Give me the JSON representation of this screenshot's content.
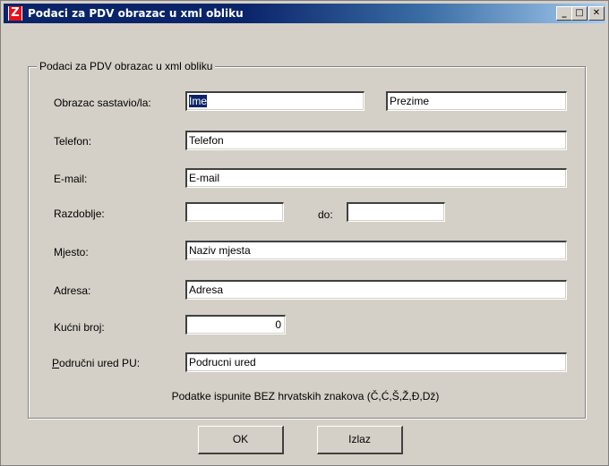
{
  "window": {
    "title": "Podaci za PDV obrazac u xml obliku",
    "icon": "Z",
    "controls": {
      "minimize": "_",
      "maximize": "□",
      "close": "✕"
    }
  },
  "group": {
    "title": "Podaci za PDV obrazac u xml obliku"
  },
  "form": {
    "author_label": "Obrazac sastavio/la:",
    "first_name": "Ime",
    "last_name": "Prezime",
    "phone_label": "Telefon:",
    "phone": "Telefon",
    "email_label": "E-mail:",
    "email": "E-mail",
    "period_label": "Razdoblje:",
    "period_from": "",
    "period_to_label": "do:",
    "period_to": "",
    "city_label": "Mjesto:",
    "city": "Naziv mjesta",
    "address_label": "Adresa:",
    "address": "Adresa",
    "house_no_label": "Kućni broj:",
    "house_no": "0",
    "office_label_first": "P",
    "office_label_rest": "odručni ured PU:",
    "office": "Podrucni ured"
  },
  "note": "Podatke ispunite BEZ hrvatskih znakova (Č,Ć,Š,Ž,Đ,Dž)",
  "buttons": {
    "ok": "OK",
    "exit": "Izlaz"
  }
}
